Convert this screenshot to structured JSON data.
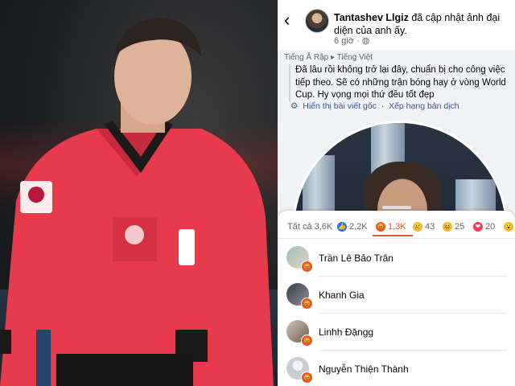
{
  "post": {
    "author": "Tantashev Llgiz",
    "action": "đã cập nhật ảnh đại diện của anh ấy.",
    "time": "6 giờ · ◍",
    "translation_bar": "Tiếng Ả Rập  ▸  Tiếng Việt",
    "body": "Đã lâu rồi không trở lại đây, chuẩn bị cho công việc tiếp theo. Sẽ có những trận bóng hay ở vòng World Cup. Hy vọng mọi thứ đều tốt đẹp",
    "show_original": "Hiển thị bài viết gốc",
    "rate_translation": "Xếp hạng bản dịch",
    "back_icon": "‹"
  },
  "reactions": {
    "tabs": [
      {
        "label": "Tất cả 3,6K",
        "icon": "all-icon",
        "color": ""
      },
      {
        "label": "2,2K",
        "icon": "like-icon",
        "color": "#1877f2"
      },
      {
        "label": "1,3K",
        "icon": "angry-icon",
        "color": "#e8572a"
      },
      {
        "label": "43",
        "icon": "sad-icon",
        "color": "#f7b928"
      },
      {
        "label": "25",
        "icon": "haha-icon",
        "color": "#f7b928"
      },
      {
        "label": "20",
        "icon": "love-icon",
        "color": "#f33e58"
      }
    ],
    "active_tab": 2,
    "users": [
      {
        "name": "Trần Lê Bảo Trân"
      },
      {
        "name": "Khanh Gia"
      },
      {
        "name": "Linhh Đặngg"
      },
      {
        "name": "Nguyễn Thiện Thành"
      }
    ]
  },
  "colors": {
    "fb_link": "#385898",
    "angry": "#e8572a",
    "like": "#1877f2"
  }
}
